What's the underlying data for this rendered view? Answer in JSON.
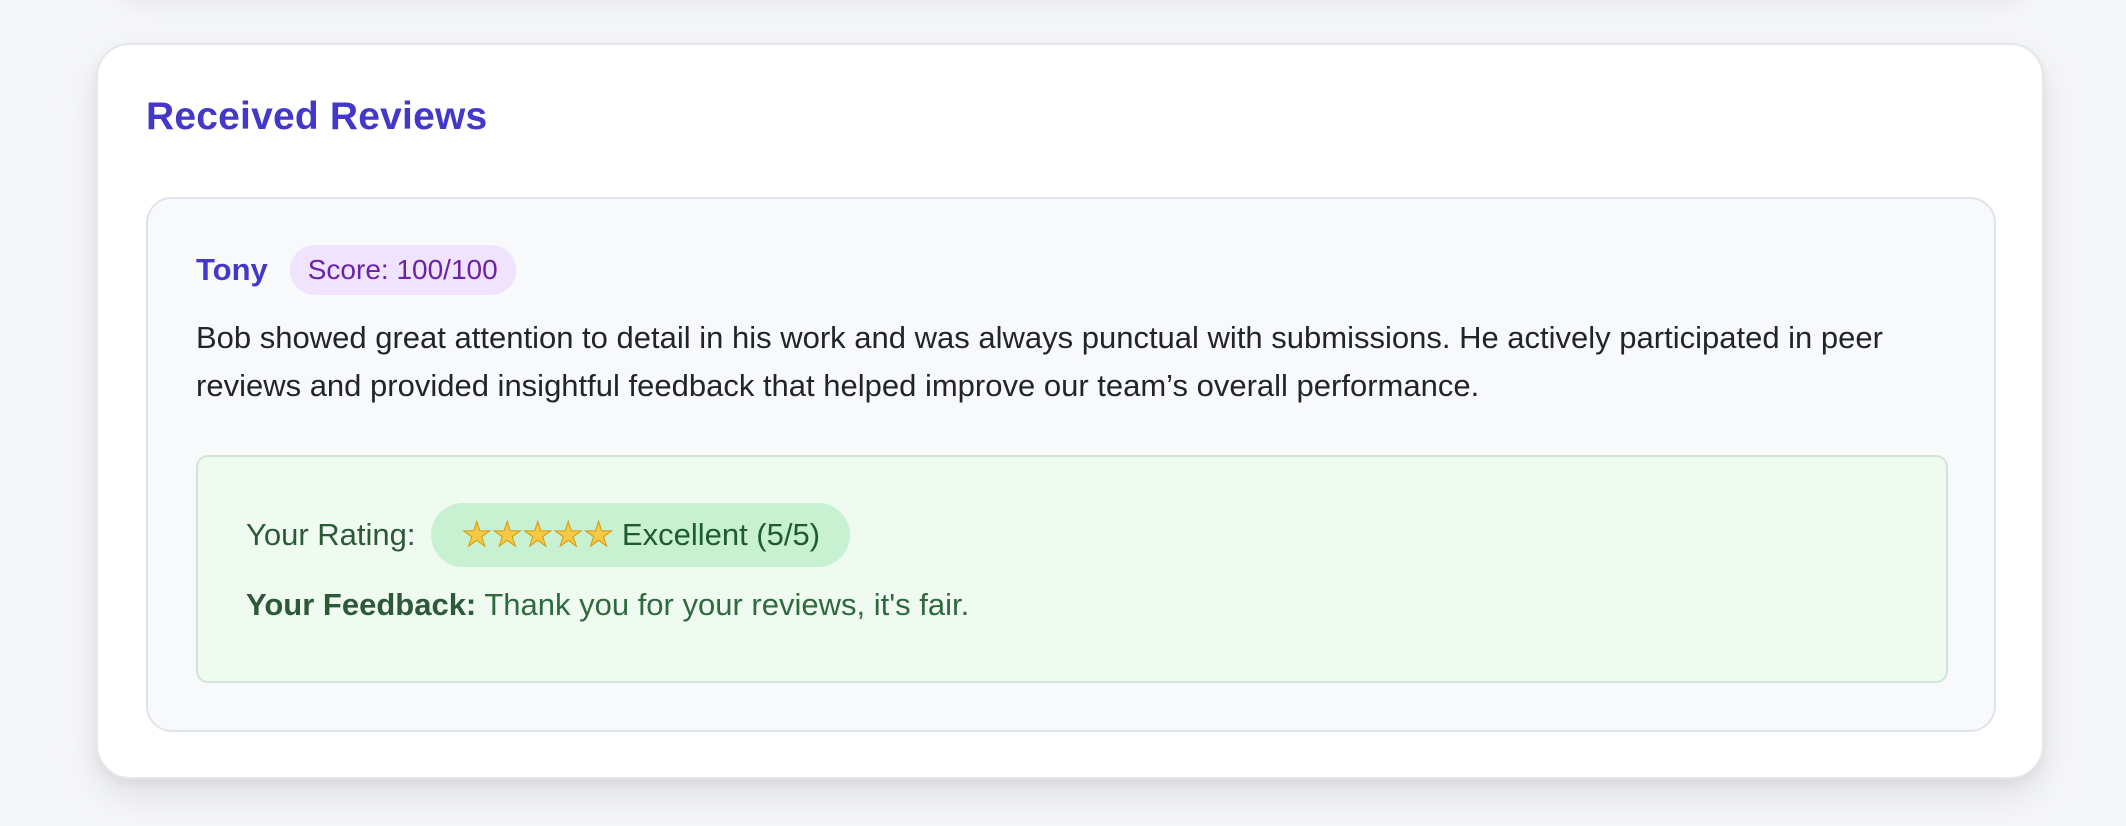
{
  "section": {
    "title": "Received Reviews"
  },
  "review": {
    "reviewer": "Tony",
    "score": "Score: 100/100",
    "text": "Bob showed great attention to detail in his work and was always punctual with submissions. He actively participated in peer reviews and provided insightful feedback that helped improve our team’s overall performance."
  },
  "response": {
    "rating_label": "Your Rating:",
    "stars": 5,
    "star_max": 5,
    "rating_text": "Excellent (5/5)",
    "feedback_label": "Your Feedback:",
    "feedback_text": "Thank you for your reviews, it's fair."
  },
  "colors": {
    "accent": "#4338ca",
    "score_badge_bg": "#f0e3fd",
    "score_badge_text": "#6b21a8",
    "response_bg": "#effbf1",
    "rating_pill_bg": "#c8f1d2",
    "rating_text": "#1f5b30"
  }
}
